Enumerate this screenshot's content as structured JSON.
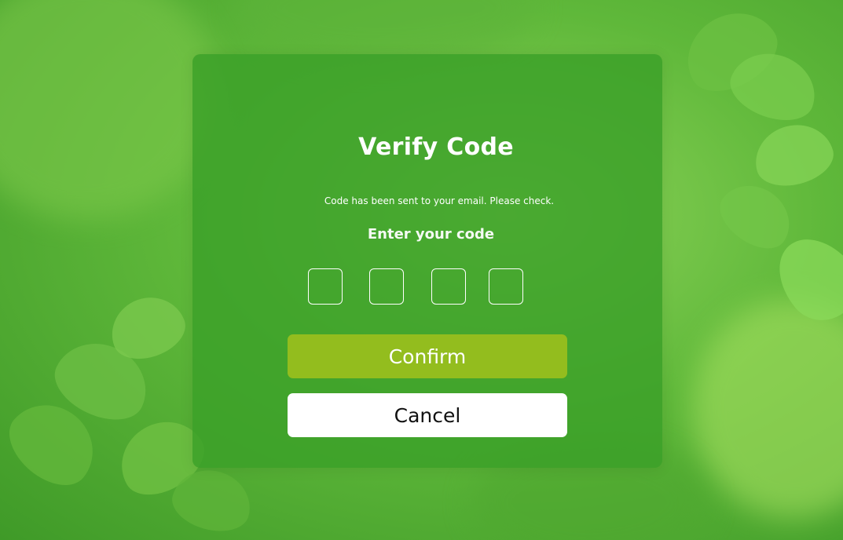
{
  "dialog": {
    "title": "Verify Code",
    "subtitle": "Code has been sent to your email. Please check.",
    "enter_label": "Enter your code",
    "code_digits": [
      "",
      "",
      "",
      ""
    ],
    "confirm_label": "Confirm",
    "cancel_label": "Cancel"
  },
  "colors": {
    "background": "#5fb83a",
    "card": "#3aa028",
    "confirm_button": "#93bd1e",
    "cancel_button": "#ffffff"
  }
}
